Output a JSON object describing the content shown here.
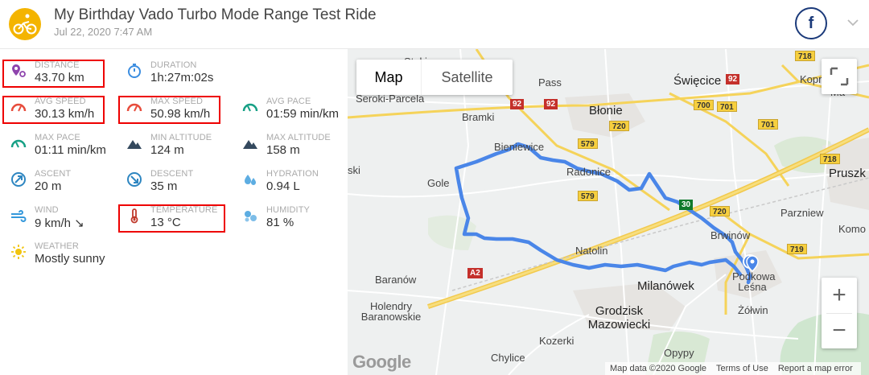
{
  "header": {
    "title": "My Birthday Vado Turbo Mode Range Test Ride",
    "subtitle": "Jul 22, 2020 7:47 AM",
    "share_label": "f"
  },
  "stats": [
    {
      "name": "distance",
      "label": "DISTANCE",
      "value": "43.70 km",
      "icon": "map-pin-icon",
      "color": "#8e44ad",
      "highlighted": true
    },
    {
      "name": "duration",
      "label": "DURATION",
      "value": "1h:27m:02s",
      "icon": "stopwatch-icon",
      "color": "#3b8de0",
      "highlighted": false
    },
    {
      "name": "avg-speed",
      "label": "AVG SPEED",
      "value": "30.13 km/h",
      "icon": "speedometer-icon",
      "color": "#e74c3c",
      "highlighted": true
    },
    {
      "name": "max-speed",
      "label": "MAX SPEED",
      "value": "50.98 km/h",
      "icon": "speedometer-icon",
      "color": "#e74c3c",
      "highlighted": true
    },
    {
      "name": "avg-pace",
      "label": "AVG PACE",
      "value": "01:59 min/km",
      "icon": "gauge-icon",
      "color": "#16a085",
      "highlighted": false
    },
    {
      "name": "max-pace",
      "label": "MAX PACE",
      "value": "01:11 min/km",
      "icon": "gauge-icon",
      "color": "#16a085",
      "highlighted": false
    },
    {
      "name": "min-altitude",
      "label": "MIN ALTITUDE",
      "value": "124 m",
      "icon": "mountain-icon",
      "color": "#34495e",
      "highlighted": false
    },
    {
      "name": "max-altitude",
      "label": "MAX ALTITUDE",
      "value": "158 m",
      "icon": "mountain-icon",
      "color": "#34495e",
      "highlighted": false
    },
    {
      "name": "ascent",
      "label": "ASCENT",
      "value": "20 m",
      "icon": "ascent-icon",
      "color": "#2e86c1",
      "highlighted": false
    },
    {
      "name": "descent",
      "label": "DESCENT",
      "value": "35 m",
      "icon": "descent-icon",
      "color": "#2e86c1",
      "highlighted": false
    },
    {
      "name": "hydration",
      "label": "HYDRATION",
      "value": "0.94 L",
      "icon": "water-drops-icon",
      "color": "#5dade2",
      "highlighted": false
    },
    {
      "name": "wind",
      "label": "WIND",
      "value": "9 km/h ↘",
      "icon": "wind-icon",
      "color": "#3498db",
      "highlighted": false
    },
    {
      "name": "temperature",
      "label": "TEMPERATURE",
      "value": "13 °C",
      "icon": "thermometer-icon",
      "color": "#c0392b",
      "highlighted": true
    },
    {
      "name": "humidity",
      "label": "HUMIDITY",
      "value": "81 %",
      "icon": "humidity-icon",
      "color": "#5dade2",
      "highlighted": false
    },
    {
      "name": "weather",
      "label": "WEATHER",
      "value": "Mostly sunny",
      "icon": "sun-icon",
      "color": "#f1c40f",
      "highlighted": false
    }
  ],
  "map": {
    "toggle": {
      "map_label": "Map",
      "satellite_label": "Satellite",
      "selected": "Map"
    },
    "zoom_in_label": "+",
    "zoom_out_label": "−",
    "logo": "Google",
    "attribution": {
      "data": "Map data ©2020 Google",
      "terms": "Terms of Use",
      "report": "Report a map error"
    },
    "places": [
      {
        "name": "Pass"
      },
      {
        "name": "Seroki-Parcela"
      },
      {
        "name": "Bramki"
      },
      {
        "name": "Błonie"
      },
      {
        "name": "Święcice"
      },
      {
        "name": "Koprki"
      },
      {
        "name": "Bieniewice"
      },
      {
        "name": "Radonice"
      },
      {
        "name": "Gole"
      },
      {
        "name": "Pruszk"
      },
      {
        "name": "Parzniew"
      },
      {
        "name": "Komo"
      },
      {
        "name": "Brwinów"
      },
      {
        "name": "Natolin"
      },
      {
        "name": "Baranów"
      },
      {
        "name": "Milanówek"
      },
      {
        "name": "Podkowa Leśna"
      },
      {
        "name": "Żółwin"
      },
      {
        "name": "Holendry Baranowskie"
      },
      {
        "name": "Grodzisk Mazowiecki"
      },
      {
        "name": "Kozerki"
      },
      {
        "name": "Opypy"
      },
      {
        "name": "Chylice"
      },
      {
        "name": "ski"
      },
      {
        "name": "Ma"
      },
      {
        "name": "Stoki"
      }
    ],
    "roads": [
      "92",
      "92",
      "92",
      "700",
      "701",
      "701",
      "720",
      "579",
      "579",
      "720",
      "718",
      "718",
      "719",
      "A2",
      "A2",
      "30",
      "719"
    ]
  }
}
